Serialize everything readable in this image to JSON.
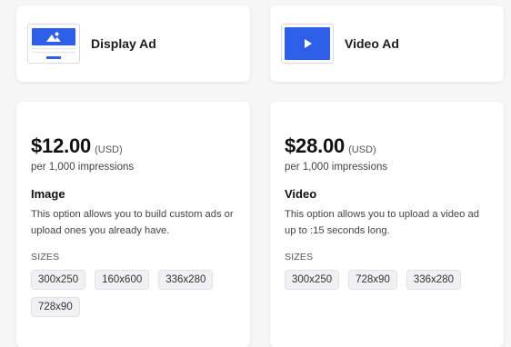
{
  "ad_types": [
    {
      "title": "Display Ad",
      "icon": "display-ad-icon"
    },
    {
      "title": "Video Ad",
      "icon": "video-ad-icon"
    }
  ],
  "options": [
    {
      "price": "$12.00",
      "currency": "(USD)",
      "per": "per 1,000 impressions",
      "kind": "Image",
      "description": "This option allows you to build custom ads or upload ones you already have.",
      "sizes_label": "SIZES",
      "sizes": [
        "300x250",
        "160x600",
        "336x280",
        "728x90"
      ]
    },
    {
      "price": "$28.00",
      "currency": "(USD)",
      "per": "per 1,000 impressions",
      "kind": "Video",
      "description": "This option allows you to upload a video ad up to :15 seconds long.",
      "sizes_label": "SIZES",
      "sizes": [
        "300x250",
        "728x90",
        "336x280"
      ]
    }
  ],
  "colors": {
    "accent": "#2e5fe8",
    "background": "#f7f7f8",
    "card": "#ffffff",
    "chip": "#f1f1f3"
  }
}
